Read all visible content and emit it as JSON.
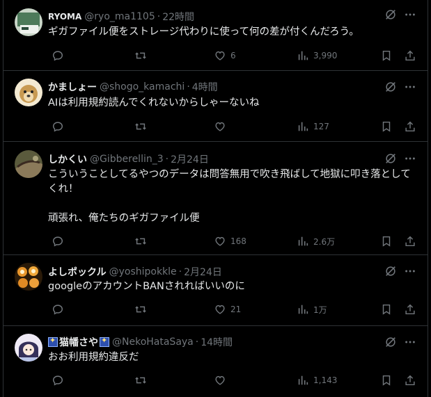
{
  "tweets": [
    {
      "name": "RYOMA",
      "handle": "@ryo_ma1105",
      "time": "22時間",
      "text": "ギガファイル便をストレージ代わりに使って何の差が付くんだろう。",
      "reply": "",
      "retweet": "",
      "like": "6",
      "views": "3,990",
      "avatar_colors": [
        "#7aa08a",
        "#cfd9cf"
      ]
    },
    {
      "name": "かましょー",
      "handle": "@shogo_kamachi",
      "time": "4時間",
      "text": "AIは利用規約読んでくれないからしゃーないね",
      "reply": "",
      "retweet": "",
      "like": "",
      "views": "127",
      "avatar_colors": [
        "#c8a060",
        "#f3e3c0"
      ]
    },
    {
      "name": "しかくい",
      "handle": "@Gibberellin_3",
      "time": "2月24日",
      "text": "こういうことしてるやつのデータは問答無用で吹き飛ばして地獄に叩き落としてくれ！\n\n頑張れ、俺たちのギガファイル便",
      "reply": "",
      "retweet": "",
      "like": "168",
      "views": "2.6万",
      "avatar_colors": [
        "#6b6a4a",
        "#a08a6a"
      ]
    },
    {
      "name": "よしポックル",
      "handle": "@yoshipokkle",
      "time": "2月24日",
      "text": "googleのアカウントBANされればいいのに",
      "reply": "",
      "retweet": "",
      "like": "21",
      "views": "1万",
      "avatar_colors": [
        "#8a5a1a",
        "#e59a30"
      ]
    },
    {
      "name": "猫幡さや",
      "handle": "@NekoHataSaya",
      "time": "14時間",
      "text": "おお利用規約違反だ",
      "reply": "",
      "retweet": "",
      "like": "",
      "views": "1,143",
      "avatar_colors": [
        "#e8e4f0",
        "#3a3560"
      ]
    }
  ],
  "separator": "·"
}
